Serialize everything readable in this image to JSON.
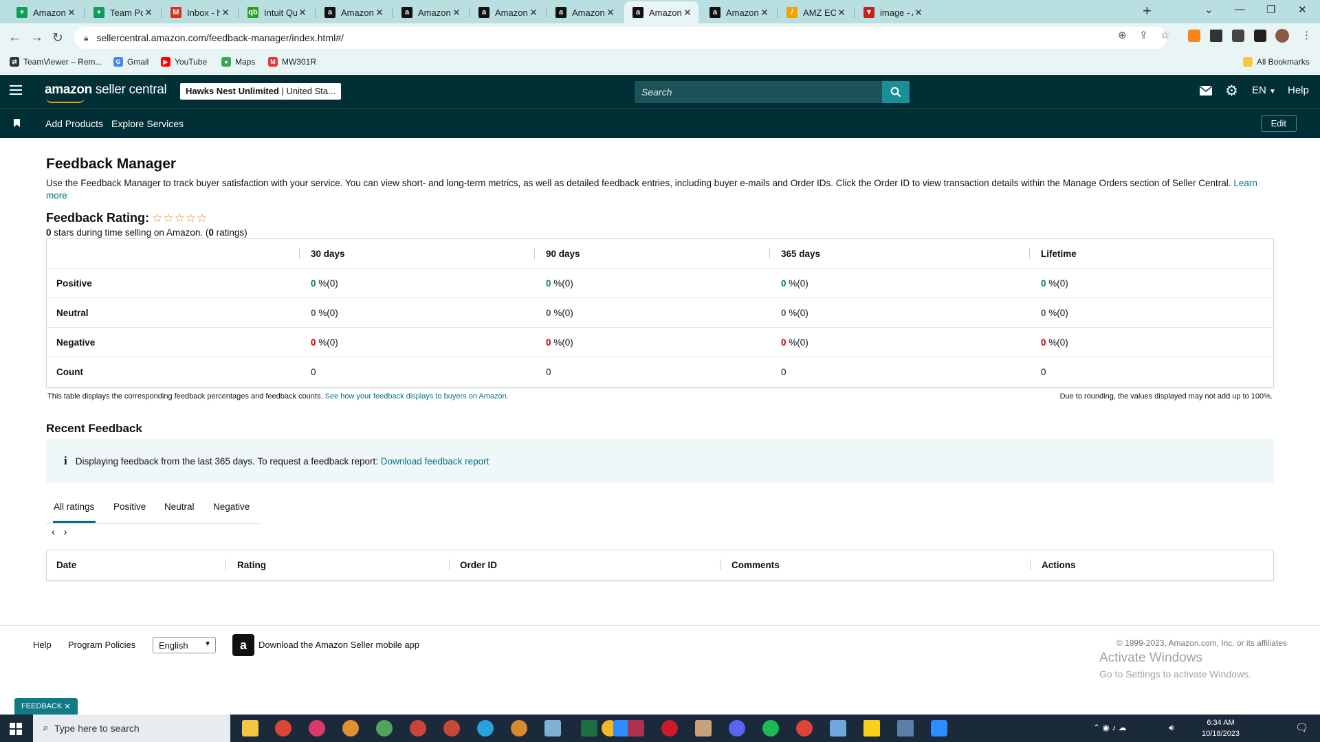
{
  "browser": {
    "tabs": [
      {
        "label": "Amazon Clin",
        "icon": "sheets-icon",
        "color": "#0f9d58",
        "glyph": "+"
      },
      {
        "label": "Team Poseid",
        "icon": "sheets-icon",
        "color": "#0f9d58",
        "glyph": "+"
      },
      {
        "label": "Inbox - hawk",
        "icon": "gmail-icon",
        "color": "#d93025",
        "glyph": "M"
      },
      {
        "label": "Intuit QuickB",
        "icon": "quickbooks-icon",
        "color": "#2ca01c",
        "glyph": "qb"
      },
      {
        "label": "Amazon",
        "icon": "amazon-icon",
        "color": "#111111",
        "glyph": "a"
      },
      {
        "label": "Amazon",
        "icon": "amazon-icon",
        "color": "#111111",
        "glyph": "a"
      },
      {
        "label": "Amazon",
        "icon": "amazon-icon",
        "color": "#111111",
        "glyph": "a"
      },
      {
        "label": "Amazon",
        "icon": "amazon-icon",
        "color": "#111111",
        "glyph": "a"
      },
      {
        "label": "Amazon",
        "icon": "amazon-icon",
        "color": "#111111",
        "glyph": "a",
        "active": true
      },
      {
        "label": "Amazon",
        "icon": "amazon-icon",
        "color": "#111111",
        "glyph": "a"
      },
      {
        "label": "AMZ EOD Re",
        "icon": "pencil-icon",
        "color": "#f4a300",
        "glyph": "/"
      },
      {
        "label": "image - AWL",
        "icon": "gmail-v-icon",
        "color": "#c5221f",
        "glyph": "▼"
      }
    ],
    "url": "sellercentral.amazon.com/feedback-manager/index.html#/",
    "bookmarks": [
      {
        "label": "TeamViewer – Rem...",
        "icon": "teamviewer-icon",
        "color": "#333333",
        "glyph": "⇄"
      },
      {
        "label": "Gmail",
        "icon": "google-icon",
        "color": "#4285f4",
        "glyph": "G"
      },
      {
        "label": "YouTube",
        "icon": "youtube-icon",
        "color": "#ff0000",
        "glyph": "▶"
      },
      {
        "label": "Maps",
        "icon": "maps-icon",
        "color": "#34a853",
        "glyph": "●"
      },
      {
        "label": "MW301R",
        "icon": "mw-icon",
        "color": "#e53935",
        "glyph": "M"
      }
    ],
    "all_bookmarks": "All Bookmarks"
  },
  "header": {
    "logo_bold": "amazon",
    "logo_rest": " seller central",
    "store_name": "Hawks Nest Unlimited",
    "store_region": " | United Sta...",
    "search_placeholder": "Search",
    "language": "EN",
    "help": "Help"
  },
  "nav": {
    "add_products": "Add Products",
    "explore_services": "Explore Services",
    "edit": "Edit"
  },
  "page": {
    "title": "Feedback Manager",
    "intro": "Use the Feedback Manager to track buyer satisfaction with your service. You can view short- and long-term metrics, as well as detailed feedback entries, including buyer e-mails and Order IDs. Click the Order ID to view transaction details within the Manage Orders section of Seller Central.",
    "learn_more": "Learn more",
    "rating_label": "Feedback Rating:",
    "stars": "☆☆☆☆☆",
    "rating_value": "0",
    "rating_text_mid": " stars during time selling on Amazon. (",
    "rating_count": "0",
    "rating_text_end": " ratings)"
  },
  "feedback_table": {
    "columns": [
      "30 days",
      "90 days",
      "365 days",
      "Lifetime"
    ],
    "rows": [
      {
        "label": "Positive",
        "kind": "pos",
        "cells": [
          {
            "v": "0",
            "t": " %(0)"
          },
          {
            "v": "0",
            "t": " %(0)"
          },
          {
            "v": "0",
            "t": " %(0)"
          },
          {
            "v": "0",
            "t": " %(0)"
          }
        ]
      },
      {
        "label": "Neutral",
        "kind": "neu",
        "cells": [
          {
            "v": "0",
            "t": " %(0)"
          },
          {
            "v": "0",
            "t": " %(0)"
          },
          {
            "v": "0",
            "t": " %(0)"
          },
          {
            "v": "0",
            "t": " %(0)"
          }
        ]
      },
      {
        "label": "Negative",
        "kind": "neg",
        "cells": [
          {
            "v": "0",
            "t": " %(0)"
          },
          {
            "v": "0",
            "t": " %(0)"
          },
          {
            "v": "0",
            "t": " %(0)"
          },
          {
            "v": "0",
            "t": " %(0)"
          }
        ]
      },
      {
        "label": "Count",
        "kind": "count",
        "cells": [
          {
            "v": "0",
            "t": ""
          },
          {
            "v": "0",
            "t": ""
          },
          {
            "v": "0",
            "t": ""
          },
          {
            "v": "0",
            "t": ""
          }
        ]
      }
    ],
    "note": "This table displays the corresponding feedback percentages and feedback counts.",
    "note_link": "See how your feedback displays to buyers on Amazon.",
    "rounding_note": "Due to rounding, the values displayed may not add up to 100%."
  },
  "recent": {
    "title": "Recent Feedback",
    "info": "Displaying feedback from the last 365 days. To request a feedback report:",
    "info_link": "Download feedback report",
    "tabs": [
      "All ratings",
      "Positive",
      "Neutral",
      "Negative"
    ],
    "columns": [
      "Date",
      "Rating",
      "Order ID",
      "Comments",
      "Actions"
    ]
  },
  "footer": {
    "help": "Help",
    "program_policies": "Program Policies",
    "language": "English",
    "app_text": "Download the Amazon Seller mobile app",
    "copyright": "© 1999-2023, Amazon.com, Inc. or its affiliates",
    "activate_title": "Activate Windows",
    "activate_sub": "Go to Settings to activate Windows.",
    "feedback_tab": "FEEDBACK"
  },
  "taskbar": {
    "search_placeholder": "Type here to search",
    "time": "6:34 AM",
    "date": "10/18/2023"
  },
  "colors": {
    "header_bg": "#002f36",
    "accent": "#007185",
    "positive": "#067d62",
    "negative": "#c40000"
  }
}
